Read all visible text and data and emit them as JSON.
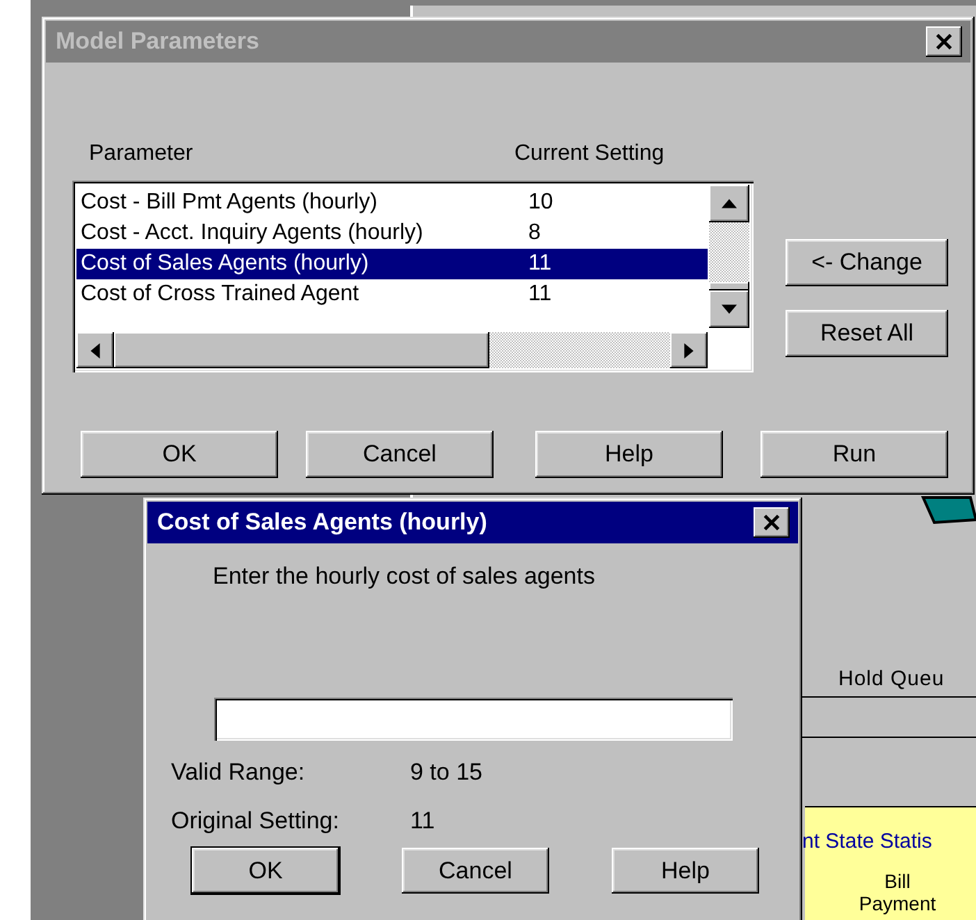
{
  "background_window": {
    "queue_label": "Hold Queu",
    "stats_title": "nt State Statis",
    "stats_column": [
      "Bill",
      "Payment"
    ]
  },
  "model_parameters": {
    "title": "Model Parameters",
    "active": false,
    "columns": [
      "Parameter",
      "Current Setting"
    ],
    "rows": [
      {
        "parameter": "Cost - Bill Pmt Agents (hourly)",
        "setting": "10",
        "selected": false
      },
      {
        "parameter": "Cost - Acct. Inquiry Agents (hourly)",
        "setting": "8",
        "selected": false
      },
      {
        "parameter": "Cost of Sales Agents (hourly)",
        "setting": "11",
        "selected": true
      },
      {
        "parameter": "Cost of Cross Trained Agent",
        "setting": "11",
        "selected": false
      }
    ],
    "side_buttons": [
      "<- Change",
      "Reset All"
    ],
    "buttons": [
      "OK",
      "Cancel",
      "Help",
      "Run"
    ]
  },
  "edit_dialog": {
    "title": "Cost of Sales Agents (hourly)",
    "active": true,
    "prompt": "Enter the hourly cost of sales agents",
    "fields": [
      {
        "label": "Valid Range:",
        "value": "9 to 15"
      },
      {
        "label": "Original Setting:",
        "value": "11"
      }
    ],
    "buttons": [
      "OK",
      "Cancel",
      "Help"
    ]
  }
}
